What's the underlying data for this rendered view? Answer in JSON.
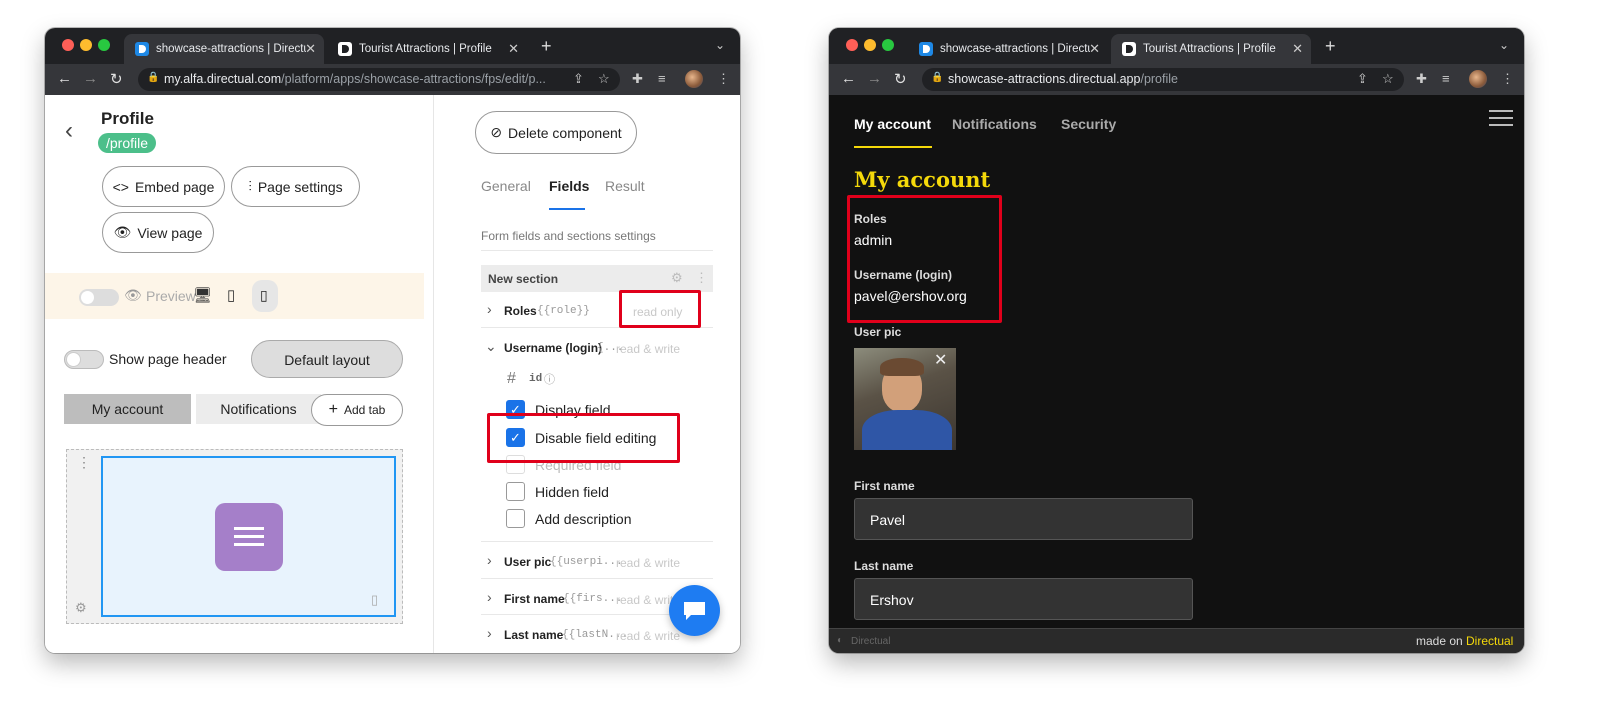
{
  "left_window": {
    "tabs": [
      {
        "title": "showcase-attractions | Directual",
        "active": true
      },
      {
        "title": "Tourist Attractions | Profile",
        "active": false
      }
    ],
    "url_host": "my.alfa.directual.com",
    "url_path": "/platform/apps/showcase-attractions/fps/edit/p...",
    "page_title": "Profile",
    "route_badge": "/profile",
    "buttons": {
      "embed": "Embed page",
      "settings": "Page settings",
      "view": "View page"
    },
    "preview_label": "Preview",
    "show_header_label": "Show page header",
    "layout_button": "Default layout",
    "page_tabs": [
      "My account",
      "Notifications"
    ],
    "add_tab": "Add tab",
    "delete_component": "Delete component",
    "settings_tabs": [
      "General",
      "Fields",
      "Result"
    ],
    "active_settings_tab": "Fields",
    "section_caption": "Form fields and sections settings",
    "section_name": "New section",
    "fields": [
      {
        "label": "Roles",
        "tag": "{{role}}",
        "mode": "read only"
      },
      {
        "label": "Username (login)",
        "tag": "{...",
        "mode": "read & write"
      },
      {
        "label": "User pic",
        "tag": "{{userpi...",
        "mode": "read & write"
      },
      {
        "label": "First name",
        "tag": "{{firs...",
        "mode": "read & write"
      },
      {
        "label": "Last name",
        "tag": "{{lastN...",
        "mode": "read & write"
      }
    ],
    "id_label": "id",
    "options": [
      {
        "label": "Display field",
        "checked": true
      },
      {
        "label": "Disable field editing",
        "checked": true
      },
      {
        "label": "Required field",
        "checked": false
      },
      {
        "label": "Hidden field",
        "checked": false
      },
      {
        "label": "Add description",
        "checked": false
      }
    ]
  },
  "right_window": {
    "tabs": [
      {
        "title": "showcase-attractions | Directual",
        "active": false
      },
      {
        "title": "Tourist Attractions | Profile",
        "active": true
      }
    ],
    "url_host": "showcase-attractions.directual.app",
    "url_path": "/profile",
    "nav": [
      "My account",
      "Notifications",
      "Security"
    ],
    "heading": "My account",
    "roles_label": "Roles",
    "roles_value": "admin",
    "username_label": "Username (login)",
    "username_value": "pavel@ershov.org",
    "userpic_label": "User pic",
    "first_name_label": "First name",
    "first_name_value": "Pavel",
    "last_name_label": "Last name",
    "last_name_value": "Ershov",
    "footer_brand": "Directual",
    "footer_made_on": "made on",
    "footer_link": "Directual"
  },
  "colors": {
    "accent": "#1a73e8",
    "badge": "#4cbf8a",
    "highlight": "#e0001b",
    "yellow": "#f5d90a"
  }
}
